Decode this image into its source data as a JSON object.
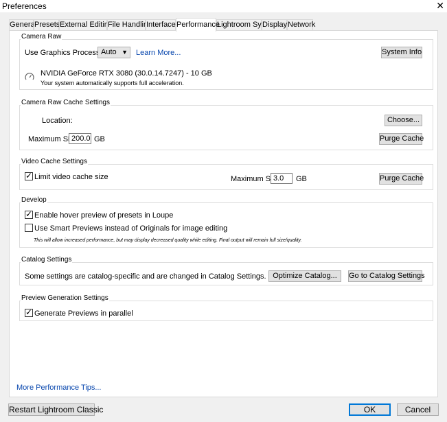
{
  "window": {
    "title": "Preferences",
    "close_glyph": "✕"
  },
  "tabs": [
    {
      "label": "General"
    },
    {
      "label": "Presets"
    },
    {
      "label": "External Editing"
    },
    {
      "label": "File Handling"
    },
    {
      "label": "Interface"
    },
    {
      "label": "Performance",
      "active": true
    },
    {
      "label": "Lightroom Sync"
    },
    {
      "label": "Display"
    },
    {
      "label": "Network"
    }
  ],
  "camera_raw": {
    "title": "Camera Raw",
    "gpu_label": "Use Graphics Processor :",
    "gpu_value": "Auto",
    "learn_more": "Learn More...",
    "system_info": "System Info",
    "gpu_name": "NVIDIA GeForce RTX 3080 (30.0.14.7247) - 10 GB",
    "gpu_note": "Your system automatically supports full acceleration.",
    "icon": "gauge-icon"
  },
  "cache": {
    "title": "Camera Raw Cache Settings",
    "location_label": "Location:",
    "choose": "Choose...",
    "max_label": "Maximum Size:",
    "max_value": "200.0",
    "unit": "GB",
    "purge": "Purge Cache"
  },
  "video_cache": {
    "title": "Video Cache Settings",
    "limit_label": "Limit video cache size",
    "limit_checked": true,
    "max_label": "Maximum Size:",
    "max_value": "3.0",
    "unit": "GB",
    "purge": "Purge Cache"
  },
  "develop": {
    "title": "Develop",
    "hover_label": "Enable hover preview of presets in Loupe",
    "hover_checked": true,
    "smart_label": "Use Smart Previews instead of Originals for image editing",
    "smart_checked": false,
    "note": "This will allow increased performance, but may display decreased quality while editing. Final output will remain full size/quality."
  },
  "catalog": {
    "title": "Catalog Settings",
    "text": "Some settings are catalog-specific and are changed in Catalog Settings.",
    "optimize": "Optimize Catalog...",
    "goto": "Go to Catalog Settings"
  },
  "preview": {
    "title": "Preview Generation Settings",
    "parallel_label": "Generate Previews in parallel",
    "parallel_checked": true
  },
  "footer": {
    "tips_link": "More Performance Tips...",
    "restart": "Restart Lightroom Classic",
    "ok": "OK",
    "cancel": "Cancel"
  },
  "colors": {
    "accent": "#0078d7",
    "link": "#0645ad"
  }
}
